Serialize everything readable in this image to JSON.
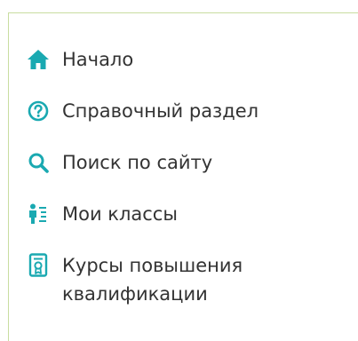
{
  "colors": {
    "accent": "#1aa9b1",
    "text": "#333333",
    "panel_border": "#c9dda0"
  },
  "menu": {
    "items": [
      {
        "label": "Начало",
        "icon": "home-icon"
      },
      {
        "label": "Справочный раздел",
        "icon": "help-circle-icon"
      },
      {
        "label": "Поиск по сайту",
        "icon": "search-icon"
      },
      {
        "label": "Мои классы",
        "icon": "classes-icon"
      },
      {
        "label_line1": "Курсы повышения",
        "label_line2": "квалификации",
        "icon": "certificate-icon"
      }
    ]
  }
}
